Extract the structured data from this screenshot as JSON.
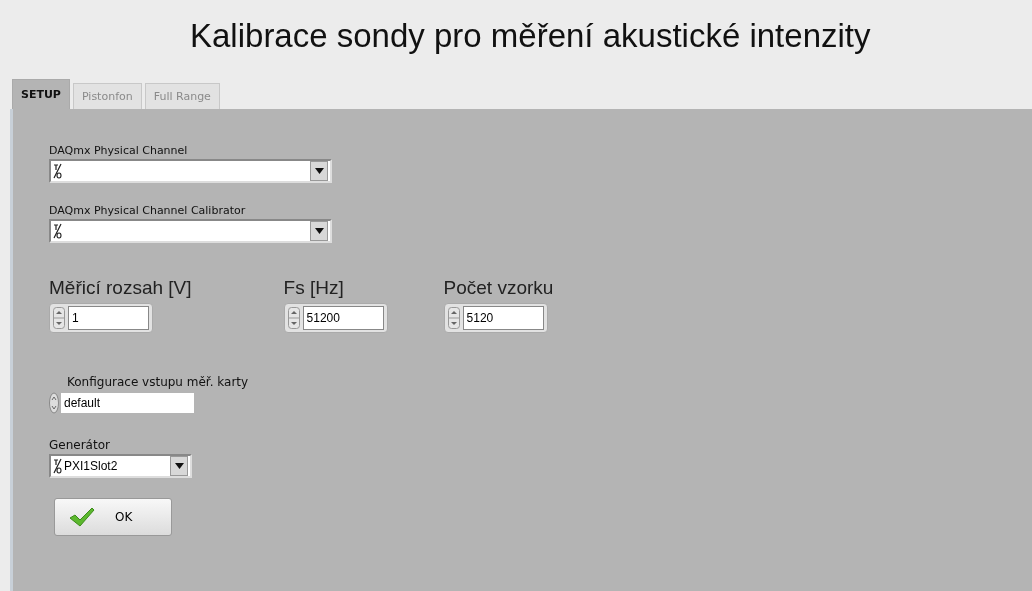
{
  "window": {
    "title": "Kalibrace sondy pro měření akustické intenzity"
  },
  "tabs": [
    {
      "label": "SETUP",
      "selected": true
    },
    {
      "label": "Pistonfon",
      "selected": false
    },
    {
      "label": "Full Range",
      "selected": false
    }
  ],
  "channels": [
    {
      "label": "DAQmx Physical Channel"
    },
    {
      "label": "DAQmx Physical Channel Calibrator"
    }
  ],
  "numerics": [
    {
      "label": "Měřicí rozsah [V]",
      "value": "1"
    },
    {
      "label": "Fs [Hz]",
      "value": "51200"
    },
    {
      "label": "Počet vzorku",
      "value": "5120"
    }
  ],
  "input_config": {
    "label": "Konfigurace vstupu měř. karty",
    "value": "default"
  },
  "generator": {
    "label": "Generátor",
    "value": "PXI1Slot2"
  },
  "ok_button": {
    "label": "OK"
  }
}
